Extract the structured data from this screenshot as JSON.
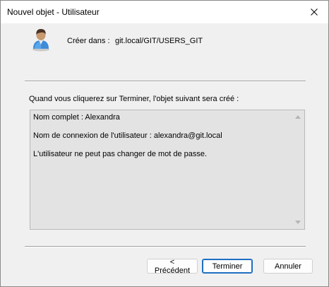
{
  "window": {
    "title": "Nouvel objet - Utilisateur",
    "close_icon": "close-icon"
  },
  "header": {
    "icon": "user-icon",
    "create_in_label": "Créer dans :",
    "create_in_value": "git.local/GIT/USERS_GIT"
  },
  "main": {
    "info_text": "Quand vous cliquerez sur Terminer, l'objet suivant sera créé :",
    "summary_lines": [
      "Nom complet : Alexandra",
      "Nom de connexion de l'utilisateur : alexandra@git.local",
      "L'utilisateur ne peut pas changer de mot de passe."
    ]
  },
  "buttons": {
    "previous": "< Précédent",
    "finish": "Terminer",
    "cancel": "Annuler"
  },
  "colors": {
    "dialog_bg": "#f0f0f0",
    "summary_bg": "#e3e3e3",
    "default_button_border": "#1f6fc1"
  }
}
